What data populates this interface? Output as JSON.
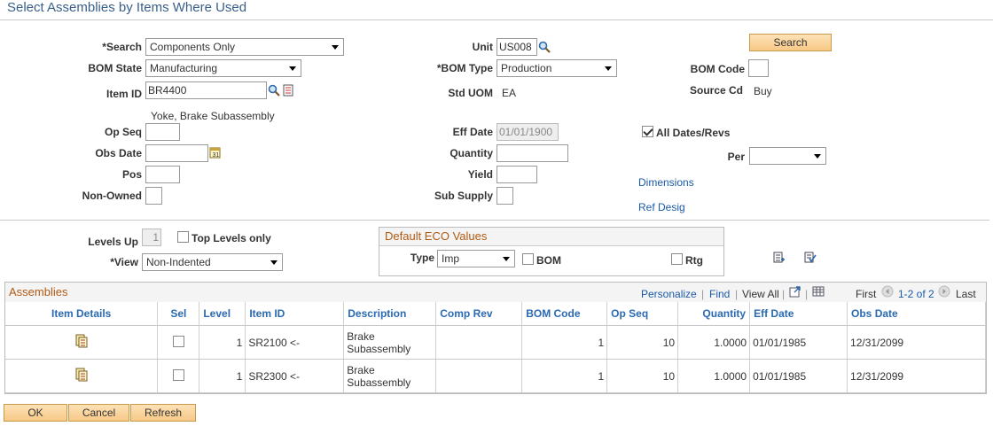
{
  "page": {
    "title": "Select Assemblies by Items Where Used"
  },
  "form": {
    "search_label": "*Search",
    "search_value": "Components  Only",
    "bom_state_label": "BOM State",
    "bom_state_value": "Manufacturing",
    "item_id_label": "Item ID",
    "item_id_value": "BR4400",
    "item_desc": "Yoke, Brake Subassembly",
    "op_seq_label": "Op Seq",
    "obs_date_label": "Obs Date",
    "pos_label": "Pos",
    "non_owned_label": "Non-Owned",
    "unit_label": "Unit",
    "unit_value": "US008",
    "bom_type_label": "*BOM Type",
    "bom_type_value": "Production",
    "std_uom_label": "Std UOM",
    "std_uom_value": "EA",
    "eff_date_label": "Eff Date",
    "eff_date_value": "01/01/1900",
    "quantity_label": "Quantity",
    "yield_label": "Yield",
    "sub_supply_label": "Sub Supply",
    "search_button": "Search",
    "bom_code_label": "BOM Code",
    "source_cd_label": "Source Cd",
    "source_cd_value": "Buy",
    "all_dates_label": "All Dates/Revs",
    "all_dates_checked": true,
    "per_label": "Per",
    "dimensions_link": "Dimensions",
    "ref_desig_link": "Ref Desig",
    "levels_up_label": "Levels Up",
    "levels_up_value": "1",
    "top_levels_label": "Top Levels only",
    "view_label": "*View",
    "view_value": "Non-Indented"
  },
  "eco": {
    "title": "Default ECO Values",
    "type_label": "Type",
    "type_value": "Imp",
    "bom_label": "BOM",
    "rtg_label": "Rtg"
  },
  "grid": {
    "title": "Assemblies",
    "personalize": "Personalize",
    "find": "Find",
    "view_all": "View All",
    "first": "First",
    "range": "1-2 of 2",
    "last": "Last",
    "columns": [
      "Item Details",
      "Sel",
      "Level",
      "Item ID",
      "Description",
      "Comp Rev",
      "BOM Code",
      "Op Seq",
      "Quantity",
      "Eff Date",
      "Obs Date"
    ],
    "rows": [
      {
        "level": "1",
        "item_id": "SR2100 <-",
        "desc1": "Brake",
        "desc2": "Subassembly",
        "comp_rev": "",
        "bom_code": "1",
        "op_seq": "10",
        "quantity": "1.0000",
        "eff_date": "01/01/1985",
        "obs_date": "12/31/2099"
      },
      {
        "level": "1",
        "item_id": "SR2300 <-",
        "desc1": "Brake",
        "desc2": "Subassembly",
        "comp_rev": "",
        "bom_code": "1",
        "op_seq": "10",
        "quantity": "1.0000",
        "eff_date": "01/01/1985",
        "obs_date": "12/31/2099"
      }
    ]
  },
  "footer": {
    "ok": "OK",
    "cancel": "Cancel",
    "refresh": "Refresh"
  },
  "colors": {
    "accent": "#3a5f8a",
    "link": "#1a5aa8",
    "group_title": "#b15a12",
    "button": "#f7c886"
  }
}
